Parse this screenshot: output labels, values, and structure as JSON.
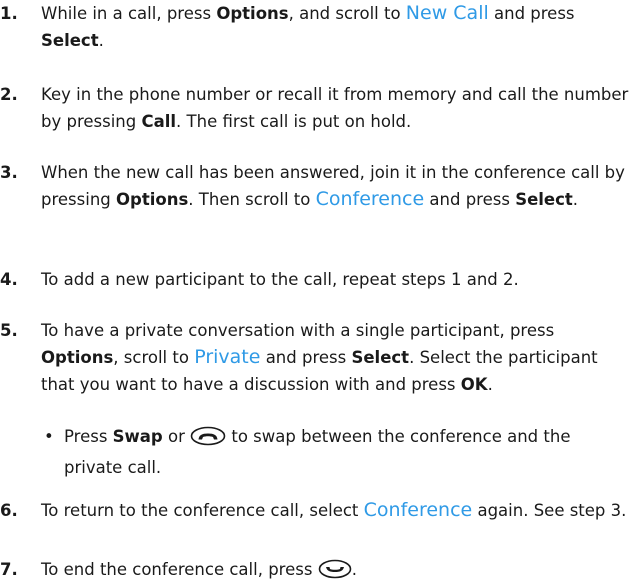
{
  "steps": [
    {
      "num": "1.",
      "parts": [
        [
          "t",
          "While in a call, press "
        ],
        [
          "b",
          "Options"
        ],
        [
          "t",
          ", and scroll to "
        ],
        [
          "m",
          "New Call"
        ],
        [
          "t",
          " and press "
        ],
        [
          "b",
          "Select"
        ],
        [
          "t",
          "."
        ]
      ]
    },
    {
      "num": "2.",
      "parts": [
        [
          "t",
          "Key in the phone number or recall it from memory and call the number by pressing "
        ],
        [
          "b",
          "Call"
        ],
        [
          "t",
          ". The first call is put on hold."
        ]
      ]
    },
    {
      "num": "3.",
      "parts": [
        [
          "t",
          "When the new call has been answered, join it in the conference call by pressing "
        ],
        [
          "b",
          "Options"
        ],
        [
          "t",
          ". Then scroll to "
        ],
        [
          "m",
          "Conference"
        ],
        [
          "t",
          " and press "
        ],
        [
          "b",
          "Select"
        ],
        [
          "t",
          "."
        ]
      ]
    },
    {
      "num": "4.",
      "parts": [
        [
          "t",
          "To add a new participant to the call, repeat steps 1 and 2."
        ]
      ]
    },
    {
      "num": "5.",
      "parts": [
        [
          "t",
          "To have a private conversation with a single participant, press "
        ],
        [
          "b",
          "Options"
        ],
        [
          "t",
          ", scroll to "
        ],
        [
          "m",
          "Private"
        ],
        [
          "t",
          " and press "
        ],
        [
          "b",
          "Select"
        ],
        [
          "t",
          ". Select the participant that you want to have a discussion with and press "
        ],
        [
          "b",
          "OK"
        ],
        [
          "t",
          "."
        ]
      ]
    },
    {
      "num": "6.",
      "parts": [
        [
          "t",
          "To return to the conference call, select "
        ],
        [
          "m",
          "Conference"
        ],
        [
          "t",
          " again. See step 3."
        ]
      ]
    },
    {
      "num": "7.",
      "parts": [
        [
          "t",
          "To end the conference call, press "
        ],
        [
          "icon",
          "end-call-key-icon"
        ],
        [
          "t",
          "."
        ]
      ]
    }
  ],
  "bullet": {
    "symbol": "•",
    "parts": [
      [
        "t",
        "Press "
      ],
      [
        "b",
        "Swap"
      ],
      [
        "t",
        " or "
      ],
      [
        "icon",
        "send-call-key-icon"
      ],
      [
        "t",
        " to swap between the conference and the private call."
      ]
    ]
  },
  "colors": {
    "menu_term": "#2f9ae6",
    "text": "#1a1a1a"
  }
}
